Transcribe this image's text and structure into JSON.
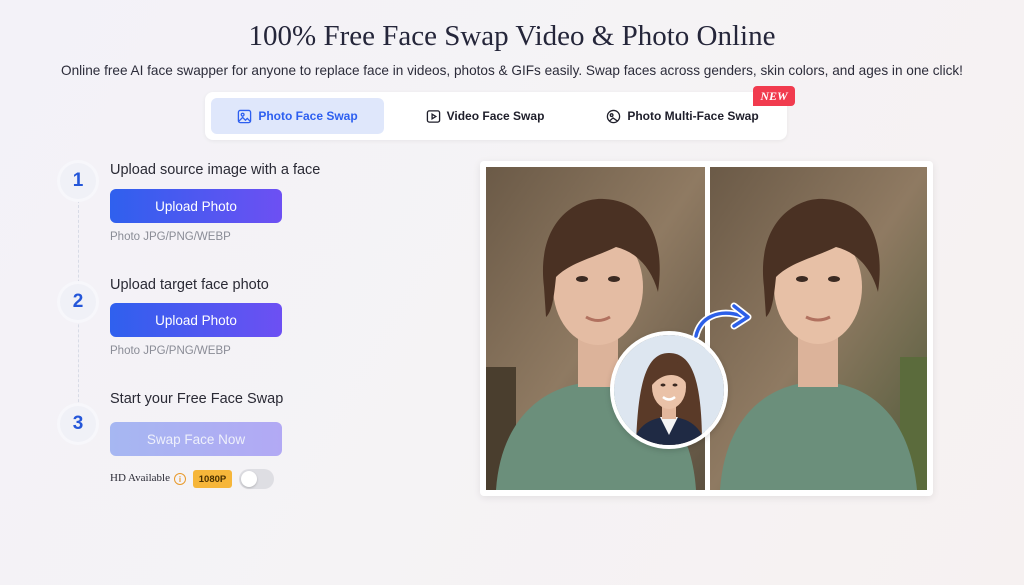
{
  "header": {
    "title": "100% Free Face Swap Video & Photo Online",
    "subtitle": "Online free AI face swapper for anyone to replace face in videos, photos & GIFs easily. Swap faces across genders, skin colors, and ages in one click!"
  },
  "tabs": [
    {
      "label": "Photo Face Swap",
      "icon": "image-icon",
      "active": true
    },
    {
      "label": "Video Face Swap",
      "icon": "play-icon",
      "active": false
    },
    {
      "label": "Photo Multi-Face Swap",
      "icon": "multi-face-icon",
      "active": false,
      "badge": "NEW"
    }
  ],
  "steps": [
    {
      "number": "1",
      "title": "Upload source image with a face",
      "button": "Upload Photo",
      "hint": "Photo JPG/PNG/WEBP"
    },
    {
      "number": "2",
      "title": "Upload target face photo",
      "button": "Upload Photo",
      "hint": "Photo JPG/PNG/WEBP"
    },
    {
      "number": "3",
      "title": "Start your Free Face Swap",
      "button": "Swap Face Now"
    }
  ],
  "hd": {
    "label": "HD Available",
    "info_icon": "i",
    "resolution": "1080P",
    "enabled": false
  },
  "colors": {
    "accent": "#2d5ff0",
    "button_gradient_start": "#2f60ee",
    "button_gradient_end": "#6d50f3",
    "new_badge": "#f13b4e",
    "resolution_badge": "#f6b63a"
  }
}
